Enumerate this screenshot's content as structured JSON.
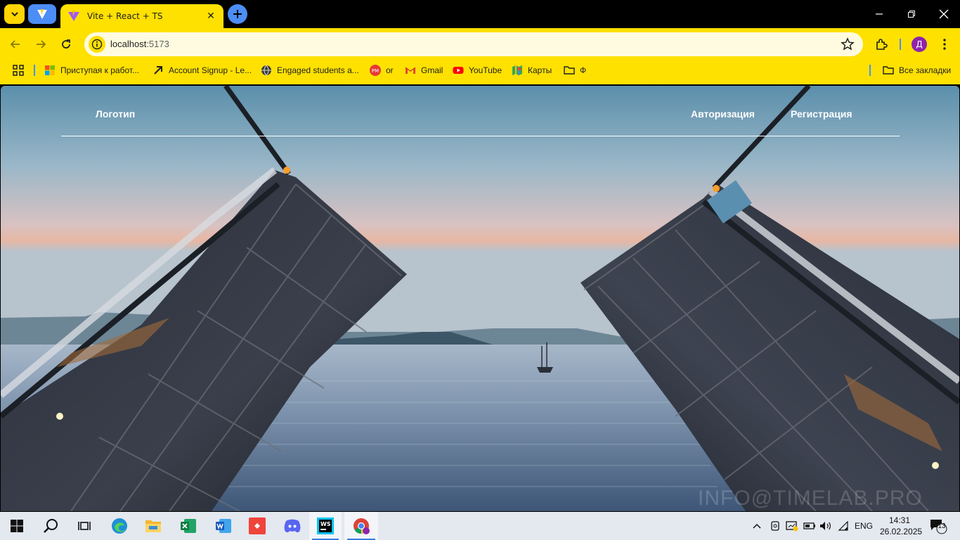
{
  "browser": {
    "tab": {
      "title": "Vite + React + TS"
    },
    "address": {
      "host": "localhost",
      "port": ":5173"
    },
    "profile_initial": "Д"
  },
  "bookmarks": {
    "items": [
      {
        "label": "Приступая к работ...",
        "icon": "microsoft-icon"
      },
      {
        "label": "Account Signup - Le...",
        "icon": "arrow-icon"
      },
      {
        "label": "Engaged students a...",
        "icon": "globe-icon"
      },
      {
        "label": "or",
        "icon": "pm-icon"
      },
      {
        "label": "Gmail",
        "icon": "gmail-icon"
      },
      {
        "label": "YouTube",
        "icon": "youtube-icon"
      },
      {
        "label": "Карты",
        "icon": "maps-icon"
      },
      {
        "label": "Ф",
        "icon": "folder-icon"
      }
    ],
    "all_label": "Все закладки"
  },
  "site": {
    "logo": "Логотип",
    "nav": {
      "login": "Авторизация",
      "register": "Регистрация"
    },
    "watermark": "INFO@TIMELAB.PRO"
  },
  "taskbar": {
    "apps": [
      "start-icon",
      "search-icon",
      "task-view-icon",
      "edge-icon",
      "file-explorer-icon",
      "excel-icon",
      "word-icon",
      "anydesk-icon",
      "discord-icon",
      "webstorm-icon",
      "chrome-icon"
    ],
    "language": "ENG",
    "time": "14:31",
    "date": "26.02.2025",
    "notifications": "13"
  },
  "colors": {
    "chrome_accent": "#ffe100",
    "blue": "#4c8df6"
  }
}
